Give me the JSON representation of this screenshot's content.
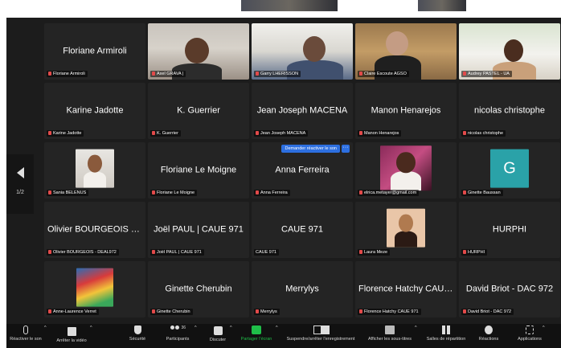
{
  "pager": {
    "page": "1/2"
  },
  "tiles": [
    {
      "id": "floriane-armiroli",
      "name": "Floriane Armiroli",
      "label": "Floriane Armiroli"
    },
    {
      "id": "axel-grava",
      "label": "Axel GRAVA |",
      "video": "room1"
    },
    {
      "id": "garry-lherisson",
      "label": "Garry LHERISSON",
      "video": "room2"
    },
    {
      "id": "claire-escoute",
      "label": "Claire Escoute AGSO",
      "video": "room3"
    },
    {
      "id": "audrey-pastel",
      "label": "Audrey PASTEL - UA",
      "video": "room4",
      "active": true
    },
    {
      "id": "karine-jadotte",
      "name": "Karine Jadotte",
      "label": "Karine Jadotte"
    },
    {
      "id": "k-guerrier",
      "name": "K. Guerrier",
      "label": "K. Guerrier"
    },
    {
      "id": "jean-joseph-macena",
      "name": "Jean Joseph MACENA",
      "label": "Jean Joseph MACENA"
    },
    {
      "id": "manon-henarejos",
      "name": "Manon Henarejos",
      "label": "Manon Henarejos"
    },
    {
      "id": "nicolas-christophe",
      "name": "nicolas christophe",
      "label": "nicolas christophe"
    },
    {
      "id": "sania-belenus",
      "label": "Sania BELENUS",
      "avatar": "sania"
    },
    {
      "id": "floriane-le-moigne",
      "name": "Floriane Le Moigne",
      "label": "Floriane Le Moigne"
    },
    {
      "id": "anna-ferreira",
      "name": "Anna Ferreira",
      "label": "Anna Ferreira",
      "request": "Demander réactiver le son",
      "more": "···"
    },
    {
      "id": "elrica-metayer",
      "label": "elrica.metayer@gmail.com",
      "avatar": "elrica"
    },
    {
      "id": "ginette-baussan",
      "label": "Ginette Baussan",
      "avatar": "g",
      "initial": "G"
    },
    {
      "id": "olivier-bourgeois",
      "name": "Olivier BOURGEOIS - DE...",
      "label": "Olivier BOURGEOIS - DEAL972"
    },
    {
      "id": "joel-paul",
      "name": "Joël PAUL | CAUE 971",
      "label": "Joël PAUL | CAUE 971"
    },
    {
      "id": "caue-971",
      "name": "CAUE 971",
      "label": "CAUE 971",
      "nomic": true
    },
    {
      "id": "laura-meze",
      "label": "Laura Meze",
      "avatar": "laura"
    },
    {
      "id": "hurphi",
      "name": "HURPHI",
      "label": "HURPHI"
    },
    {
      "id": "anne-laurence-verret",
      "label": "Anne-Laurence Verret",
      "avatar": "anne"
    },
    {
      "id": "ginette-cherubin",
      "name": "Ginette Cherubin",
      "label": "Ginette Cherubin"
    },
    {
      "id": "merrylys",
      "name": "Merrylys",
      "label": "Merrylys"
    },
    {
      "id": "florence-hatchy",
      "name": "Florence Hatchy CAUE...",
      "label": "Florence Hatchy CAUE 971"
    },
    {
      "id": "david-briot",
      "name": "David Briot - DAC 972",
      "label": "David Briot - DAC 972"
    }
  ],
  "toolbar": {
    "unmute": "Réactiver le son",
    "stop_video": "Arrêter la vidéo",
    "security": "Sécurité",
    "participants": "Participants",
    "participants_count": "36",
    "chat": "Discuter",
    "share": "Partager l'écran",
    "record": "Suspendre/arrêter l'enregistrement",
    "captions": "Afficher les sous-titres",
    "rooms": "Salles de répartition",
    "reactions": "Réactions",
    "apps": "Applications"
  },
  "colors": {
    "background": "#1c1c1c",
    "tile": "#242424",
    "active_speaker": "#37c94a",
    "share_green": "#1fbf49",
    "button_blue": "#2d6fe0",
    "muted_red": "#e24a4a"
  }
}
